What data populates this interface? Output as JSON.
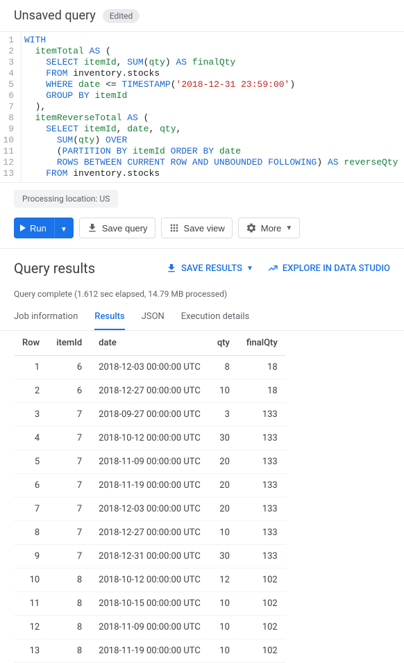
{
  "header": {
    "title": "Unsaved query",
    "badge": "Edited"
  },
  "editor": {
    "lines": [
      "WITH",
      "  itemTotal AS (",
      "    SELECT itemId, SUM(qty) AS finalQty",
      "    FROM inventory.stocks",
      "    WHERE date <= TIMESTAMP('2018-12-31 23:59:00')",
      "    GROUP BY itemId",
      "  ),",
      "  itemReverseTotal AS (",
      "    SELECT itemId, date, qty,",
      "      SUM(qty) OVER",
      "      (PARTITION BY itemId ORDER BY date",
      "      ROWS BETWEEN CURRENT ROW AND UNBOUNDED FOLLOWING) AS reverseQty",
      "    FROM inventory.stocks"
    ],
    "line_count": 13
  },
  "processing_location": "Processing location: US",
  "buttons": {
    "run": "Run",
    "save_query": "Save query",
    "save_view": "Save view",
    "more": "More"
  },
  "results": {
    "title": "Query results",
    "save_results": "SAVE RESULTS",
    "explore": "EXPLORE IN DATA STUDIO",
    "status": "Query complete (1.612 sec elapsed, 14.79 MB processed)"
  },
  "tabs": [
    "Job information",
    "Results",
    "JSON",
    "Execution details"
  ],
  "active_tab": 1,
  "table": {
    "headers": [
      "Row",
      "itemId",
      "date",
      "qty",
      "finalQty"
    ],
    "rows": [
      [
        1,
        6,
        "2018-12-03 00:00:00 UTC",
        8,
        18
      ],
      [
        2,
        6,
        "2018-12-27 00:00:00 UTC",
        10,
        18
      ],
      [
        3,
        7,
        "2018-09-27 00:00:00 UTC",
        3,
        133
      ],
      [
        4,
        7,
        "2018-10-12 00:00:00 UTC",
        30,
        133
      ],
      [
        5,
        7,
        "2018-11-09 00:00:00 UTC",
        20,
        133
      ],
      [
        6,
        7,
        "2018-11-19 00:00:00 UTC",
        20,
        133
      ],
      [
        7,
        7,
        "2018-12-03 00:00:00 UTC",
        20,
        133
      ],
      [
        8,
        7,
        "2018-12-27 00:00:00 UTC",
        10,
        133
      ],
      [
        9,
        7,
        "2018-12-31 00:00:00 UTC",
        30,
        133
      ],
      [
        10,
        8,
        "2018-10-12 00:00:00 UTC",
        12,
        102
      ],
      [
        11,
        8,
        "2018-10-15 00:00:00 UTC",
        10,
        102
      ],
      [
        12,
        8,
        "2018-11-09 00:00:00 UTC",
        10,
        102
      ],
      [
        13,
        8,
        "2018-11-19 00:00:00 UTC",
        10,
        102
      ]
    ]
  }
}
